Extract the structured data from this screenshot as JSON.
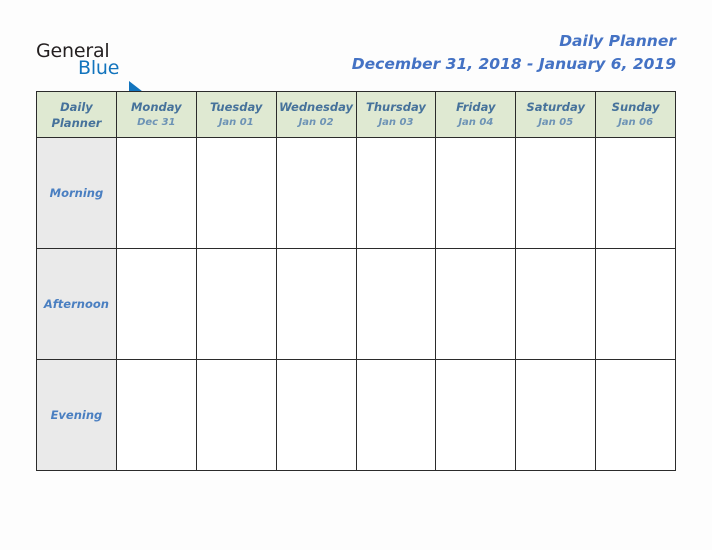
{
  "brand": {
    "name_part1": "General",
    "name_part2": "Blue",
    "logo_icon": "triangle-flag-icon",
    "color_dark": "#231f20",
    "color_blue": "#1274bd"
  },
  "header": {
    "title": "Daily Planner",
    "date_range": "December 31, 2018 - January 6, 2019",
    "title_color": "#4472c4"
  },
  "table": {
    "corner": {
      "line1": "Daily",
      "line2": "Planner"
    },
    "header_bg": "#dfe9d2",
    "row_label_bg": "#eaeaea",
    "border_color": "#2b2b2b",
    "columns": [
      {
        "day": "Monday",
        "date": "Dec 31"
      },
      {
        "day": "Tuesday",
        "date": "Jan 01"
      },
      {
        "day": "Wednesday",
        "date": "Jan 02"
      },
      {
        "day": "Thursday",
        "date": "Jan 03"
      },
      {
        "day": "Friday",
        "date": "Jan 04"
      },
      {
        "day": "Saturday",
        "date": "Jan 05"
      },
      {
        "day": "Sunday",
        "date": "Jan 06"
      }
    ],
    "rows": [
      {
        "label": "Morning",
        "cells": [
          "",
          "",
          "",
          "",
          "",
          "",
          ""
        ]
      },
      {
        "label": "Afternoon",
        "cells": [
          "",
          "",
          "",
          "",
          "",
          "",
          ""
        ]
      },
      {
        "label": "Evening",
        "cells": [
          "",
          "",
          "",
          "",
          "",
          "",
          ""
        ]
      }
    ]
  }
}
